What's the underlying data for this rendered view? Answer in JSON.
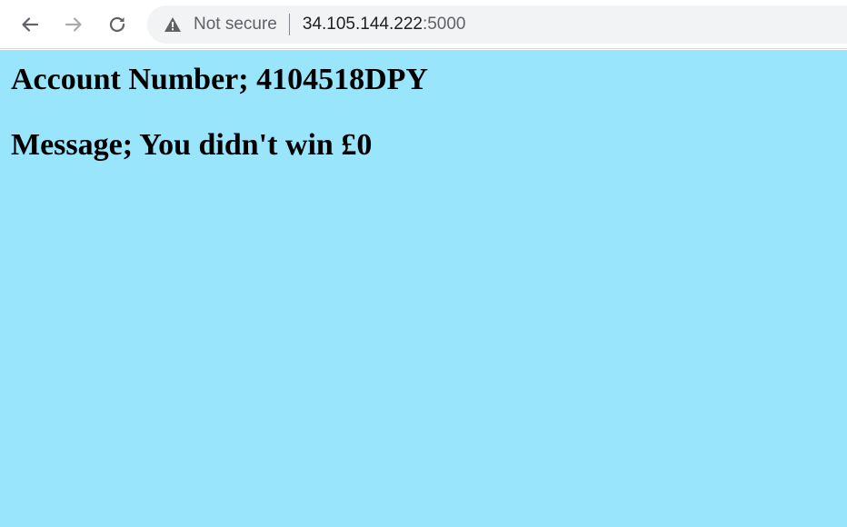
{
  "browser": {
    "security_label": "Not secure",
    "url_host": "34.105.144.222",
    "url_port": ":5000",
    "icons": {
      "back": "back-arrow-icon",
      "forward": "forward-arrow-icon",
      "reload": "reload-icon",
      "security": "warning-triangle-icon"
    }
  },
  "page": {
    "background_color": "#99e5fc",
    "account_line": "Account Number; 4104518DPY",
    "message_line": "Message; You didn't win £0"
  }
}
